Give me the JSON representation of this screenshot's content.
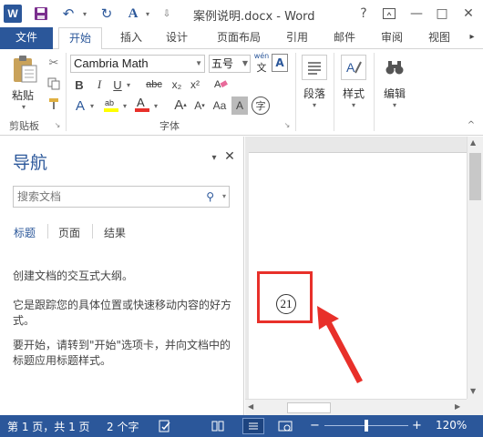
{
  "window": {
    "title": "案例说明.docx - Word",
    "help_label": "?",
    "min_label": "—",
    "max_label": "□",
    "close_label": "✕"
  },
  "qat": {
    "logo": "W",
    "save_icon": "💾",
    "undo_icon": "↶",
    "redo_icon": "↻",
    "font_color_icon": "A",
    "more_icon": "⇩"
  },
  "tabs": [
    "文件",
    "开始",
    "插入",
    "设计",
    "页面布局",
    "引用",
    "邮件",
    "审阅",
    "视图"
  ],
  "ribbon": {
    "clipboard": {
      "paste_label": "粘贴",
      "group_label": "剪贴板"
    },
    "font": {
      "font_name": "Cambria Math",
      "font_size": "五号",
      "wen_label": "wén",
      "bold": "B",
      "italic": "I",
      "underline": "U",
      "strike": "abc",
      "subscript": "x₂",
      "superscript": "x²",
      "group_label": "字体",
      "grow": "A",
      "shrink": "A",
      "case": "Aa",
      "char_shade": "A",
      "circle_char": "字"
    },
    "paragraph_label": "段落",
    "styles_label": "样式",
    "editing_label": "编辑"
  },
  "nav": {
    "title": "导航",
    "search_placeholder": "搜索文档",
    "tabs": [
      "标题",
      "页面",
      "结果"
    ],
    "paragraphs": [
      "创建文档的交互式大纲。",
      "它是跟踪您的具体位置或快速移动内容的好方式。",
      "要开始，请转到\"开始\"选项卡，并向文档中的标题应用标题样式。"
    ]
  },
  "document": {
    "circled_char": "21"
  },
  "status": {
    "page": "第 1 页，共 1 页",
    "words": "2 个字",
    "zoom": "120%",
    "zoom_minus": "−",
    "zoom_plus": "+"
  },
  "colors": {
    "accent": "#2b579a",
    "highlight_arrow": "#e8302a"
  }
}
